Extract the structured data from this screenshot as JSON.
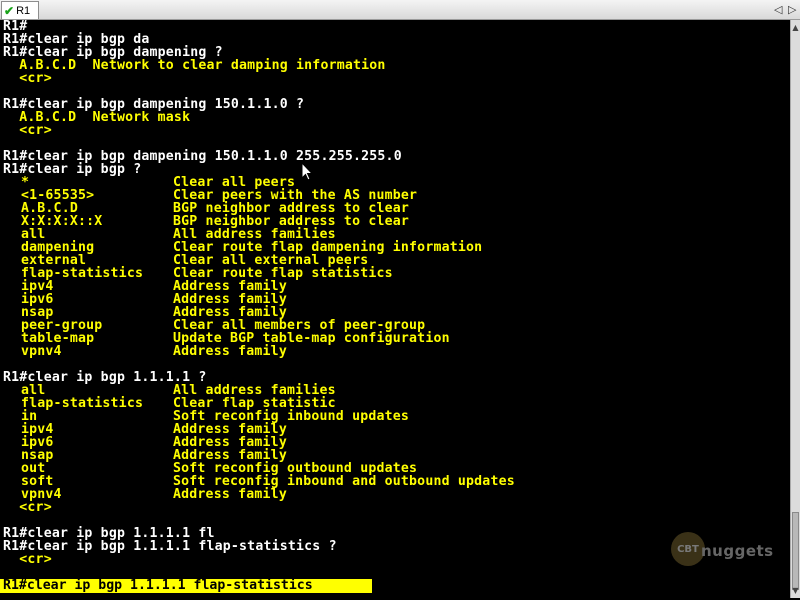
{
  "tab": {
    "label": "R1"
  },
  "tab_nav": {
    "prev": "◁",
    "next": "▷"
  },
  "terminal": {
    "lines": [
      "R1#",
      "R1#clear ip bgp da",
      "R1#clear ip bgp dampening ?",
      "  A.B.C.D  Network to clear damping information",
      "  <cr>",
      "",
      "R1#clear ip bgp dampening 150.1.1.0 ?",
      "  A.B.C.D  Network mask",
      "  <cr>",
      "",
      "R1#clear ip bgp dampening 150.1.1.0 255.255.255.0",
      "R1#clear ip bgp ?"
    ],
    "help1": [
      {
        "kw": "*",
        "desc": "Clear all peers"
      },
      {
        "kw": "<1-65535>",
        "desc": "Clear peers with the AS number"
      },
      {
        "kw": "A.B.C.D",
        "desc": "BGP neighbor address to clear"
      },
      {
        "kw": "X:X:X:X::X",
        "desc": "BGP neighbor address to clear"
      },
      {
        "kw": "all",
        "desc": "All address families"
      },
      {
        "kw": "dampening",
        "desc": "Clear route flap dampening information"
      },
      {
        "kw": "external",
        "desc": "Clear all external peers"
      },
      {
        "kw": "flap-statistics",
        "desc": "Clear route flap statistics"
      },
      {
        "kw": "ipv4",
        "desc": "Address family"
      },
      {
        "kw": "ipv6",
        "desc": "Address family"
      },
      {
        "kw": "nsap",
        "desc": "Address family"
      },
      {
        "kw": "peer-group",
        "desc": "Clear all members of peer-group"
      },
      {
        "kw": "table-map",
        "desc": "Update BGP table-map configuration"
      },
      {
        "kw": "vpnv4",
        "desc": "Address family"
      }
    ],
    "cmd2": "R1#clear ip bgp 1.1.1.1 ?",
    "help2": [
      {
        "kw": "all",
        "desc": "All address families"
      },
      {
        "kw": "flap-statistics",
        "desc": "Clear flap statistic"
      },
      {
        "kw": "in",
        "desc": "Soft reconfig inbound updates"
      },
      {
        "kw": "ipv4",
        "desc": "Address family"
      },
      {
        "kw": "ipv6",
        "desc": "Address family"
      },
      {
        "kw": "nsap",
        "desc": "Address family"
      },
      {
        "kw": "out",
        "desc": "Soft reconfig outbound updates"
      },
      {
        "kw": "soft",
        "desc": "Soft reconfig inbound and outbound updates"
      },
      {
        "kw": "vpnv4",
        "desc": "Address family"
      }
    ],
    "cr2": "  <cr>",
    "cmd3": "R1#clear ip bgp 1.1.1.1 fl",
    "cmd4": "R1#clear ip bgp 1.1.1.1 flap-statistics ?",
    "cr4": "  <cr>",
    "current_input": "R1#clear ip bgp 1.1.1.1 flap-statistics "
  },
  "watermark": {
    "circle": "CBT",
    "text": "nuggets"
  },
  "colors": {
    "prompt": "#ffffff",
    "output": "#ffff00",
    "highlight_bg": "#ffff00"
  }
}
